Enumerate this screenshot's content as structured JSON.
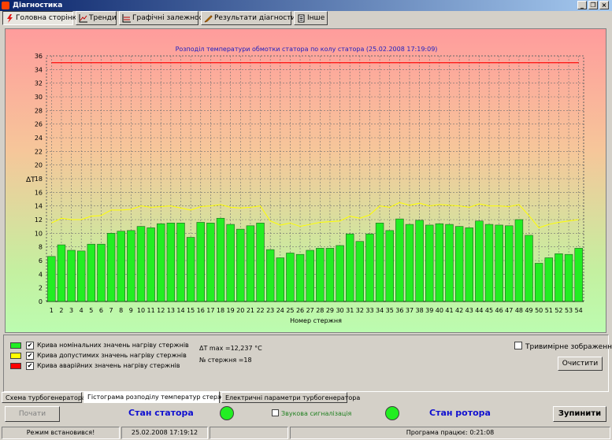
{
  "window": {
    "title": "Діагностика"
  },
  "toolbar": {
    "tabs": [
      {
        "label": "Головна сторінка",
        "icon": "lightning-icon"
      },
      {
        "label": "Тренди",
        "icon": "trend-chart-icon"
      },
      {
        "label": "Графічні залежності",
        "icon": "graph-icon"
      },
      {
        "label": "Результати діагностики",
        "icon": "pencil-icon"
      },
      {
        "label": "Інше",
        "icon": "document-icon"
      }
    ]
  },
  "chart_data": {
    "type": "bar",
    "title": "Розподіл температури обмотки статора по колу статора (25.02.2008 17:19:09)",
    "xlabel": "Номер стержня",
    "ylabel": "ΔT",
    "ylim": [
      0,
      36
    ],
    "yticks": [
      0,
      2,
      4,
      6,
      8,
      10,
      12,
      14,
      16,
      18,
      20,
      22,
      24,
      26,
      28,
      30,
      32,
      34,
      36
    ],
    "categories": [
      "1",
      "2",
      "3",
      "4",
      "5",
      "6",
      "7",
      "8",
      "9",
      "10",
      "11",
      "12",
      "13",
      "14",
      "15",
      "16",
      "17",
      "18",
      "19",
      "20",
      "21",
      "22",
      "23",
      "24",
      "25",
      "26",
      "27",
      "28",
      "29",
      "30",
      "31",
      "32",
      "33",
      "34",
      "35",
      "36",
      "37",
      "38",
      "39",
      "40",
      "41",
      "42",
      "43",
      "44",
      "45",
      "46",
      "47",
      "48",
      "49",
      "50",
      "51",
      "52",
      "53",
      "54"
    ],
    "grid": true,
    "series": [
      {
        "name": "Крива номінальних значень нагріву стержнів",
        "color": "#22ee22",
        "values": [
          6.6,
          8.3,
          7.5,
          7.4,
          8.4,
          8.4,
          10.0,
          10.3,
          10.4,
          11.0,
          10.8,
          11.4,
          11.5,
          11.5,
          9.4,
          11.6,
          11.5,
          12.2,
          11.3,
          10.6,
          11.1,
          11.5,
          7.6,
          6.4,
          7.1,
          6.9,
          7.5,
          7.8,
          7.8,
          8.2,
          9.9,
          8.8,
          9.9,
          11.5,
          10.4,
          12.1,
          11.3,
          11.9,
          11.2,
          11.4,
          11.3,
          11.0,
          10.8,
          11.8,
          11.3,
          11.2,
          11.1,
          12.0,
          9.7,
          5.6,
          6.4,
          7.0,
          6.9,
          7.8
        ]
      },
      {
        "name": "Крива допустимих значень нагріву стержнів",
        "color": "#ffff00",
        "values": [
          11.5,
          12.2,
          12.0,
          12.0,
          12.5,
          12.6,
          13.4,
          13.4,
          13.5,
          14.0,
          13.8,
          13.9,
          14.0,
          13.7,
          13.4,
          13.9,
          14.0,
          14.2,
          13.8,
          13.7,
          13.8,
          14.0,
          11.8,
          11.2,
          11.5,
          11.0,
          11.3,
          11.6,
          11.7,
          11.8,
          12.5,
          12.2,
          12.7,
          14.0,
          13.8,
          14.5,
          14.1,
          14.4,
          14.0,
          14.2,
          14.1,
          14.0,
          13.8,
          14.3,
          14.0,
          14.0,
          13.9,
          14.2,
          12.6,
          10.8,
          11.3,
          11.6,
          11.8,
          12.0
        ]
      },
      {
        "name": "Крива аварійних значень нагріву стержнів",
        "color": "#ff0000",
        "values": [
          35,
          35,
          35,
          35,
          35,
          35,
          35,
          35,
          35,
          35,
          35,
          35,
          35,
          35,
          35,
          35,
          35,
          35,
          35,
          35,
          35,
          35,
          35,
          35,
          35,
          35,
          35,
          35,
          35,
          35,
          35,
          35,
          35,
          35,
          35,
          35,
          35,
          35,
          35,
          35,
          35,
          35,
          35,
          35,
          35,
          35,
          35,
          35,
          35,
          35,
          35,
          35,
          35,
          35
        ]
      }
    ]
  },
  "legend": {
    "items": [
      {
        "label": "Крива номінальних значень нагріву стержнів",
        "color": "#22ee22",
        "checked": true
      },
      {
        "label": "Крива допустимих значень нагріву стержнів",
        "color": "#ffff00",
        "checked": true
      },
      {
        "label": "Крива аварійних значень нагріву стержнів",
        "color": "#ff0000",
        "checked": true
      }
    ]
  },
  "info": {
    "dt_max": "ΔT max =12,237 °C",
    "rod_no": "№ стержня =18"
  },
  "controls": {
    "three_d_label": "Тривимірне зображення",
    "clear_label": "Очистити"
  },
  "bottom_tabs": [
    {
      "label": "Схема турбогенератора",
      "active": false
    },
    {
      "label": "Гістограма розподілу температур стержнів",
      "active": true
    },
    {
      "label": "Електричні параметри турбогенератора",
      "active": false
    }
  ],
  "bottom": {
    "start_label": "Почати",
    "stator_label": "Стан статора",
    "sound_label": "Звукова сигналізація",
    "rotor_label": "Стан ротора",
    "stop_label": "Зупинити",
    "lamp_color": "#22ee22"
  },
  "status": {
    "mode": "Режим встановився!",
    "datetime": "25.02.2008 17:19:12",
    "blank": "",
    "runtime": "Програма працює: 0:21:08"
  }
}
